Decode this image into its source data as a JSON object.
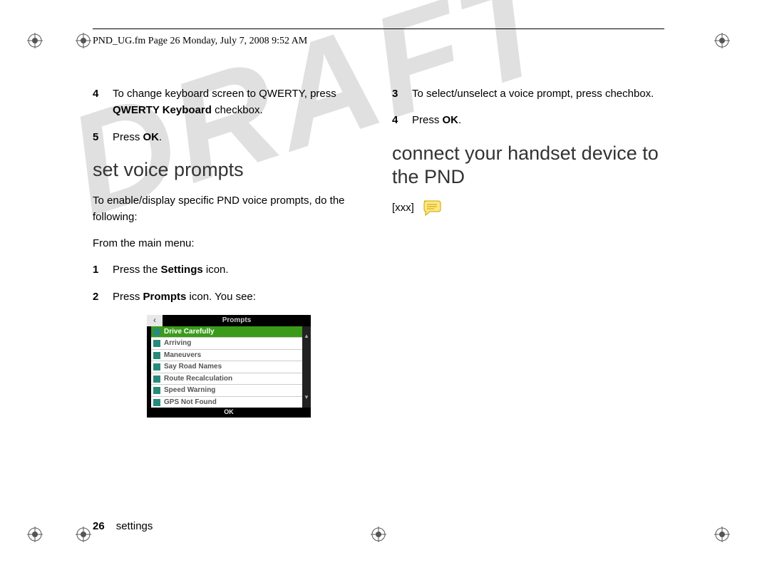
{
  "header_text": "PND_UG.fm  Page 26  Monday, July 7, 2008  9:52 AM",
  "watermark": "DRAFT",
  "left_col": {
    "step4": {
      "num": "4",
      "pre": "To change keyboard screen to QWERTY, press ",
      "bold": "QWERTY Keyboard",
      "post": " checkbox."
    },
    "step5": {
      "num": "5",
      "pre": "Press ",
      "bold": "OK",
      "post": "."
    },
    "heading": "set voice prompts",
    "intro": "To enable/display specific PND voice prompts, do the following:",
    "from_menu": "From the main menu:",
    "step1": {
      "num": "1",
      "pre": "Press the ",
      "bold": "Settings",
      "post": " icon."
    },
    "step2": {
      "num": "2",
      "pre": "Press ",
      "bold": "Prompts",
      "post": " icon. You see:"
    }
  },
  "prompts_screenshot": {
    "title": "Prompts",
    "ok": "OK",
    "items": [
      "Drive Carefully",
      "Arriving",
      "Maneuvers",
      "Say Road Names",
      "Route Recalculation",
      "Speed Warning",
      "GPS Not Found"
    ]
  },
  "right_col": {
    "step3": {
      "num": "3",
      "text": "To select/unselect a voice prompt, press chechbox."
    },
    "step4": {
      "num": "4",
      "pre": "Press ",
      "bold": "OK",
      "post": "."
    },
    "heading": "connect your handset device to the PND",
    "placeholder": "[xxx]"
  },
  "footer": {
    "pagenum": "26",
    "section": "settings"
  }
}
